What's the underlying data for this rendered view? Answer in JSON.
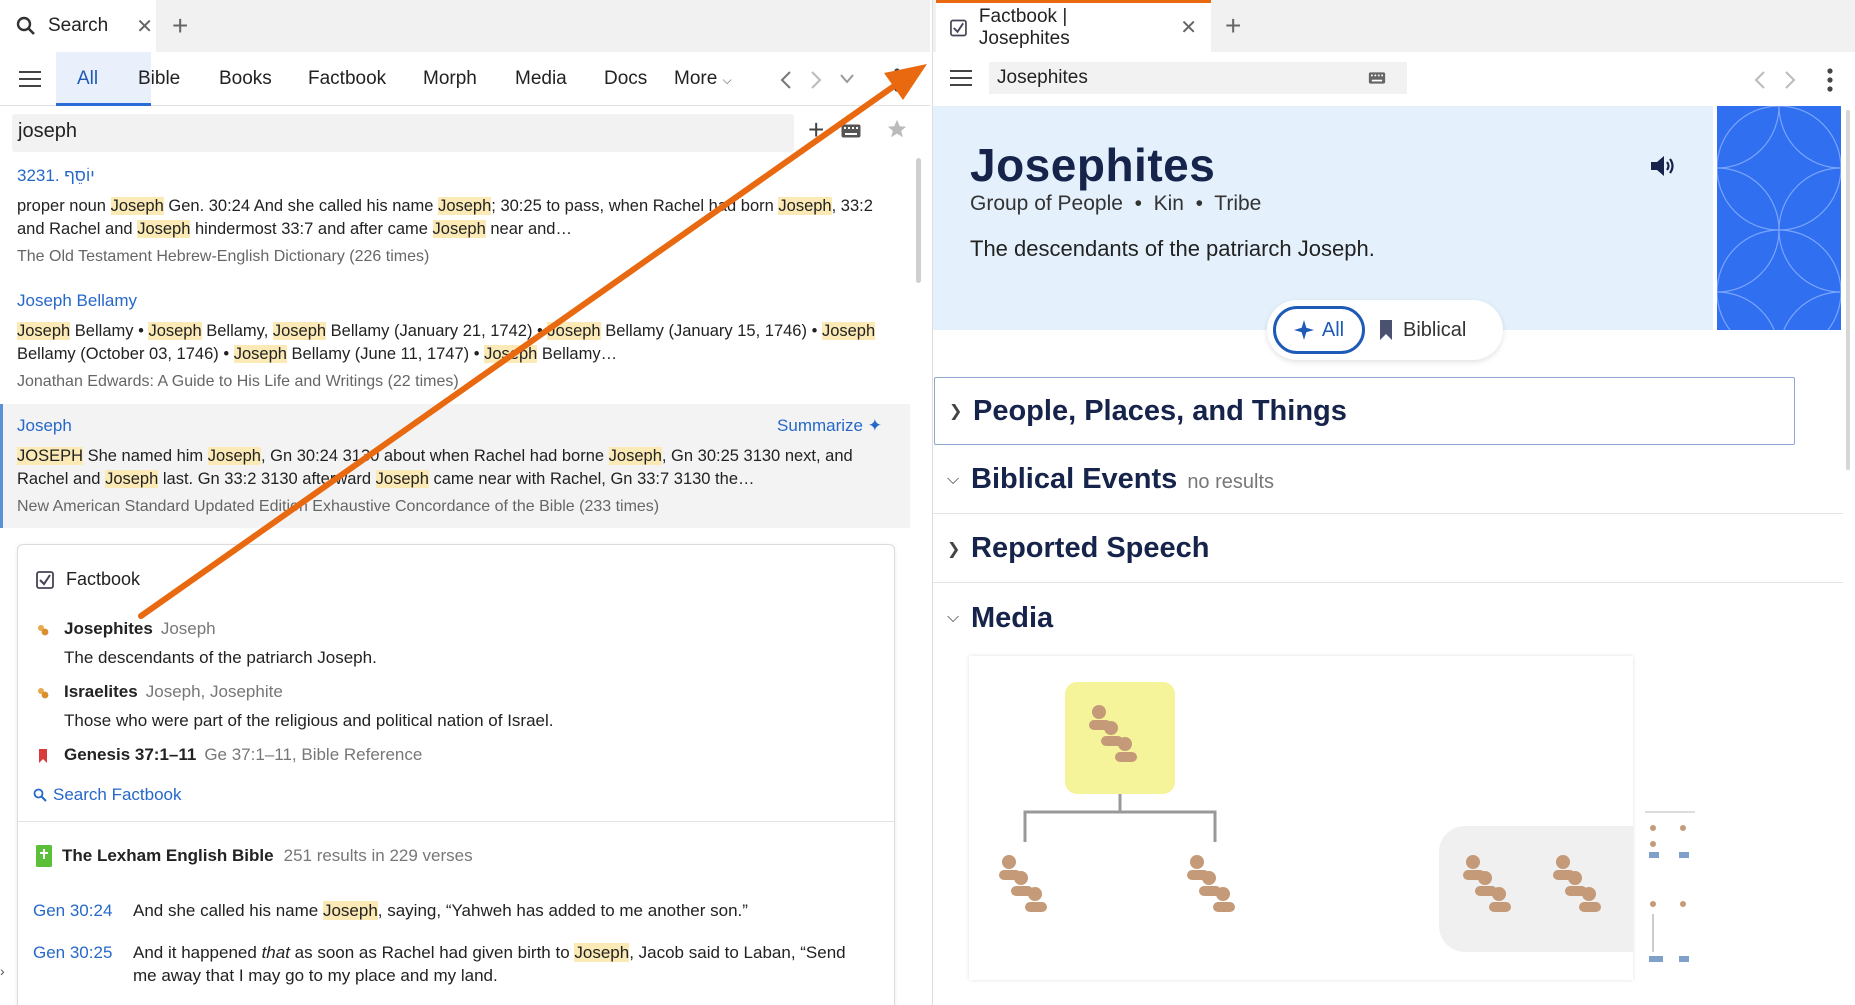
{
  "left": {
    "tab": {
      "label": "Search",
      "close": "✕",
      "add": "+"
    },
    "nav": {
      "items": [
        "All",
        "Bible",
        "Books",
        "Factbook",
        "Morph",
        "Media",
        "Docs",
        "More"
      ]
    },
    "search": {
      "value": "joseph"
    },
    "results": {
      "r1": {
        "title": "3231. יוֹסֵף",
        "b1": "proper noun ",
        "h1": "Joseph",
        "b2": " Gen. 30:24 And she called his name ",
        "h2": "Joseph",
        "b3": "; 30:25 to pass, when Rachel had born ",
        "h3": "Joseph",
        "b4": ", 33:2 and Rachel and ",
        "h4": "Joseph",
        "b5": " hindermost 33:7 and after came ",
        "h5": "Joseph",
        "b6": " near and…",
        "source": "The Old Testament Hebrew-English Dictionary (226 times)"
      },
      "r2": {
        "title": "Joseph Bellamy",
        "h1": "Joseph",
        "b1": " Bellamy • ",
        "h2": "Joseph",
        "b2": " Bellamy, ",
        "h3": "Joseph",
        "b3": " Bellamy (January 21, 1742) • ",
        "h4": "Joseph",
        "b4": " Bellamy (January 15, 1746) • ",
        "h5": "Joseph",
        "b5": " Bellamy (October 03, 1746) • ",
        "h6": "Joseph",
        "b6": " Bellamy (June 11, 1747) • ",
        "h7": "Joseph",
        "b7": " Bellamy…",
        "source": "Jonathan Edwards: A Guide to His Life and Writings (22 times)"
      },
      "r3": {
        "title": "Joseph",
        "summarize": "Summarize",
        "h1": "JOSEPH",
        "b1": " She named him ",
        "h2": "Joseph",
        "b2": ", Gn 30:24 3130 about when Rachel had borne ",
        "h3": "Joseph",
        "b3": ", Gn 30:25 3130 next, and Rachel and ",
        "h4": "Joseph",
        "b4": " last. Gn 33:2 3130 afterward ",
        "h5": "Joseph",
        "b5": " came near with Rachel, Gn 33:7 3130 the…",
        "source": "New American Standard Updated Edition Exhaustive Concordance of the Bible (233 times)"
      }
    },
    "factbook_card": {
      "heading": "Factbook",
      "items": [
        {
          "name": "Josephites",
          "alt": "Joseph",
          "desc": "The descendants of the patriarch Joseph."
        },
        {
          "name": "Israelites",
          "alt": "Joseph, Josephite",
          "desc": "Those who were part of the religious and political nation of Israel."
        },
        {
          "name": "Genesis 37:1–11",
          "alt": "Ge 37:1–11, Bible Reference"
        }
      ],
      "search_link": "Search Factbook",
      "bible": {
        "name": "The Lexham English Bible",
        "count": "251 results in 229 verses"
      },
      "verses": [
        {
          "ref": "Gen 30:24",
          "a": "And she called his name ",
          "h": "Joseph",
          "b": ", saying, “Yahweh has added to me another son.”"
        },
        {
          "ref": "Gen 30:25",
          "a": "And it happened ",
          "i": "that",
          "c": " as soon as Rachel had given birth to ",
          "h": "Joseph",
          "b": ", Jacob said to Laban, “Send me away that I may go to my place and my land."
        }
      ]
    }
  },
  "right": {
    "tab": {
      "label": "Factbook | Josephites",
      "close": "✕",
      "add": "+"
    },
    "search": {
      "value": "Josephites"
    },
    "hero": {
      "title": "Josephites",
      "subtitle": "Group of People  •  Kin  •  Tribe",
      "description": "The descendants of the patriarch Joseph."
    },
    "filters": {
      "all": "All",
      "biblical": "Biblical"
    },
    "sections": [
      {
        "name": "People, Places, and Things",
        "extra": ""
      },
      {
        "name": "Biblical Events",
        "extra": "no results"
      },
      {
        "name": "Reported Speech",
        "extra": ""
      },
      {
        "name": "Media",
        "extra": ""
      }
    ]
  },
  "colors": {
    "accent": "#2668c9",
    "highlight": "#fbeab5",
    "tab_accent": "#e8690f",
    "hero_bg": "#e4f1fc",
    "hero_art": "#2f6ff0",
    "arrow": "#e8690f"
  }
}
